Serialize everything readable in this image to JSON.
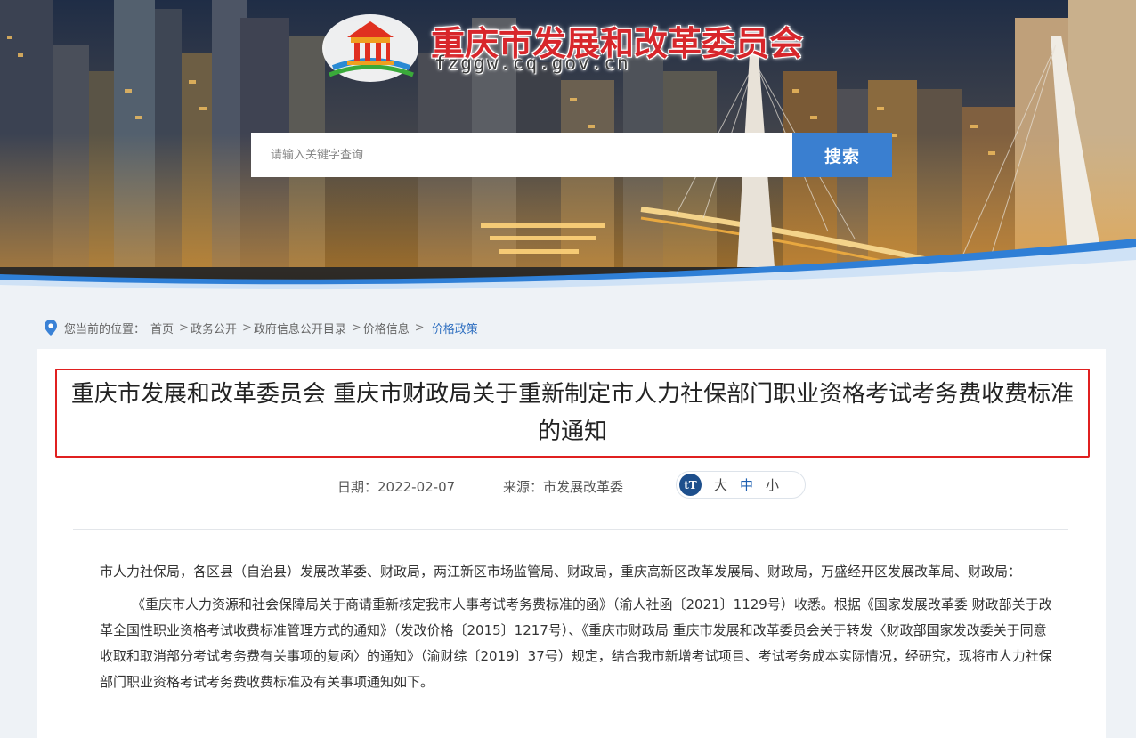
{
  "header": {
    "site_title": "重庆市发展和改革委员会",
    "site_domain": "fzggw.cq.gov.cn",
    "search": {
      "placeholder": "请输入关键字查询",
      "button_label": "搜索"
    }
  },
  "breadcrumb": {
    "prefix": "您当前的位置：",
    "items": [
      "首页",
      "政务公开",
      "政府信息公开目录",
      "价格信息"
    ],
    "separator": ">",
    "current": "价格政策"
  },
  "article": {
    "title": "重庆市发展和改革委员会 重庆市财政局关于重新制定市人力社保部门职业资格考试考务费收费标准的通知",
    "date_label": "日期：2022-02-07",
    "source_label": "来源：市发展改革委",
    "font_size": {
      "icon": "tT",
      "options": [
        "大",
        "中",
        "小"
      ],
      "selected": "中"
    },
    "paragraphs": [
      "市人力社保局，各区县（自治县）发展改革委、财政局，两江新区市场监管局、财政局，重庆高新区改革发展局、财政局，万盛经开区发展改革局、财政局：",
      "《重庆市人力资源和社会保障局关于商请重新核定我市人事考试考务费标准的函》（渝人社函〔2021〕1129号）收悉。根据《国家发展改革委 财政部关于改革全国性职业资格考试收费标准管理方式的通知》（发改价格〔2015〕1217号）、《重庆市财政局 重庆市发展和改革委员会关于转发〈财政部国家发改委关于同意收取和取消部分考试考务费有关事项的复函〉的通知》（渝财综〔2019〕37号）规定，结合我市新增考试项目、考试考务成本实际情况，经研究，现将市人力社保部门职业资格考试考务费收费标准及有关事项通知如下。"
    ]
  },
  "colors": {
    "brand_red": "#d8262b",
    "search_button": "#3a7fd0",
    "title_border": "#e02020",
    "link_blue": "#2f6fc0"
  }
}
